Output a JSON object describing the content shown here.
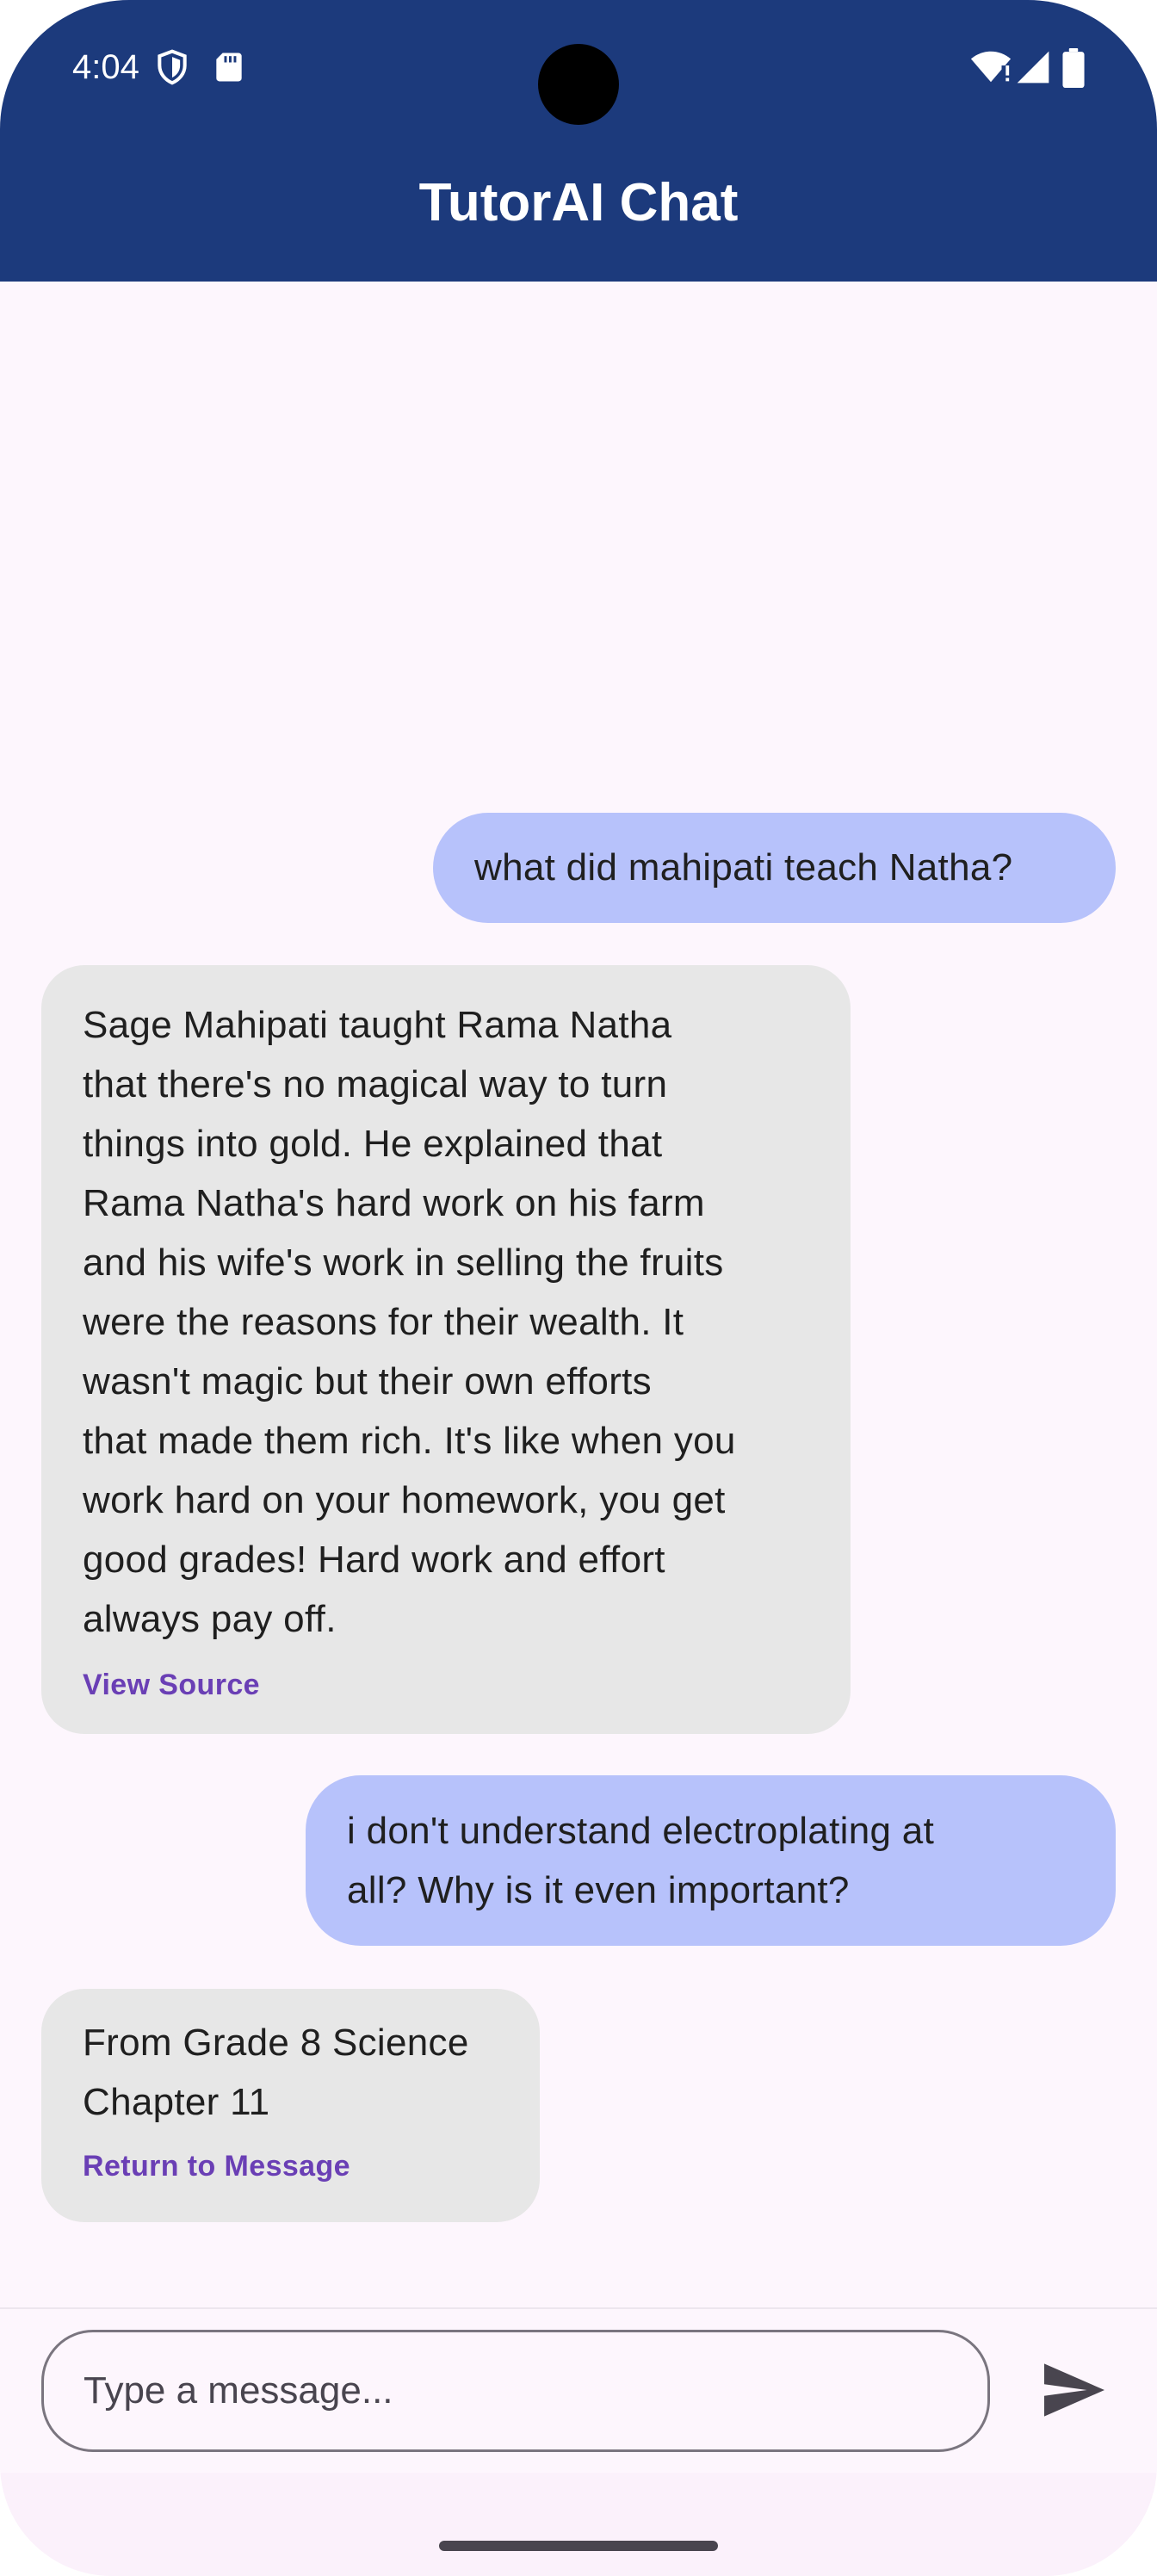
{
  "status_bar": {
    "time": "4:04",
    "left_icons": [
      "shield-icon",
      "sd-card-icon"
    ],
    "right_icons": [
      "wifi-icon",
      "signal-icon",
      "battery-icon"
    ]
  },
  "app_bar": {
    "title": "TutorAI Chat",
    "background": "#1c3a7c"
  },
  "messages": [
    {
      "role": "user",
      "text": "what did mahipati teach Natha?"
    },
    {
      "role": "bot",
      "lines": [
        "Sage Mahipati taught Rama Natha",
        "that there's no magical way to turn",
        "things into gold. He explained that",
        "Rama Natha's hard work on his farm",
        "and his wife's work in selling the fruits",
        "were the reasons for their wealth. It",
        "wasn't magic but their own efforts",
        "that made them rich. It's like when you",
        "work hard on your homework, you get",
        "good grades! Hard work and effort",
        "always pay off."
      ],
      "link": "View Source"
    },
    {
      "role": "user",
      "lines": [
        "i don't understand electroplating at",
        "all? Why is it even important?"
      ]
    },
    {
      "role": "bot",
      "lines": [
        "From Grade 8 Science",
        "Chapter 11"
      ],
      "link": "Return to Message"
    }
  ],
  "composer": {
    "placeholder": "Type a message...",
    "send_icon": "send-icon"
  },
  "colors": {
    "user_bubble": "#b7c2fb",
    "bot_bubble": "#e7e7e7",
    "link": "#6a3fb5",
    "background": "#fdf6fd"
  }
}
